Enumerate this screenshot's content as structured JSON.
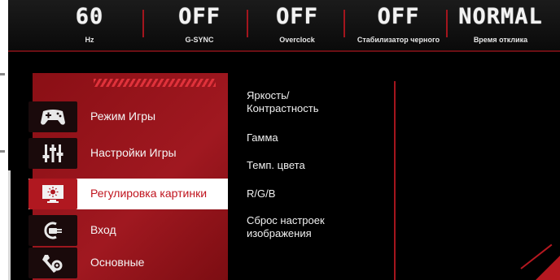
{
  "status": [
    {
      "value": "60",
      "label": "Hz"
    },
    {
      "value": "OFF",
      "label": "G-SYNC"
    },
    {
      "value": "OFF",
      "label": "Overclock"
    },
    {
      "value": "OFF",
      "label": "Стабилизатор черного"
    },
    {
      "value": "NORMAL",
      "label": "Время отклика"
    }
  ],
  "menu": [
    {
      "label": "Режим Игры",
      "icon": "gamepad-icon"
    },
    {
      "label": "Настройки Игры",
      "icon": "sliders-icon"
    },
    {
      "label": "Регулировка картинки",
      "icon": "monitor-brightness-icon",
      "active": true
    },
    {
      "label": "Вход",
      "icon": "input-plug-icon"
    },
    {
      "label": "Основные",
      "icon": "wrench-gear-icon"
    }
  ],
  "submenu": [
    {
      "label": "Яркость/ Контрастность"
    },
    {
      "label": "Гамма"
    },
    {
      "label": "Темп. цвета"
    },
    {
      "label": "R/G/B"
    },
    {
      "label": "Сброс настроек изображения"
    }
  ],
  "colors": {
    "accent": "#a01820",
    "background": "#000000",
    "active_bg": "#ffffff"
  }
}
